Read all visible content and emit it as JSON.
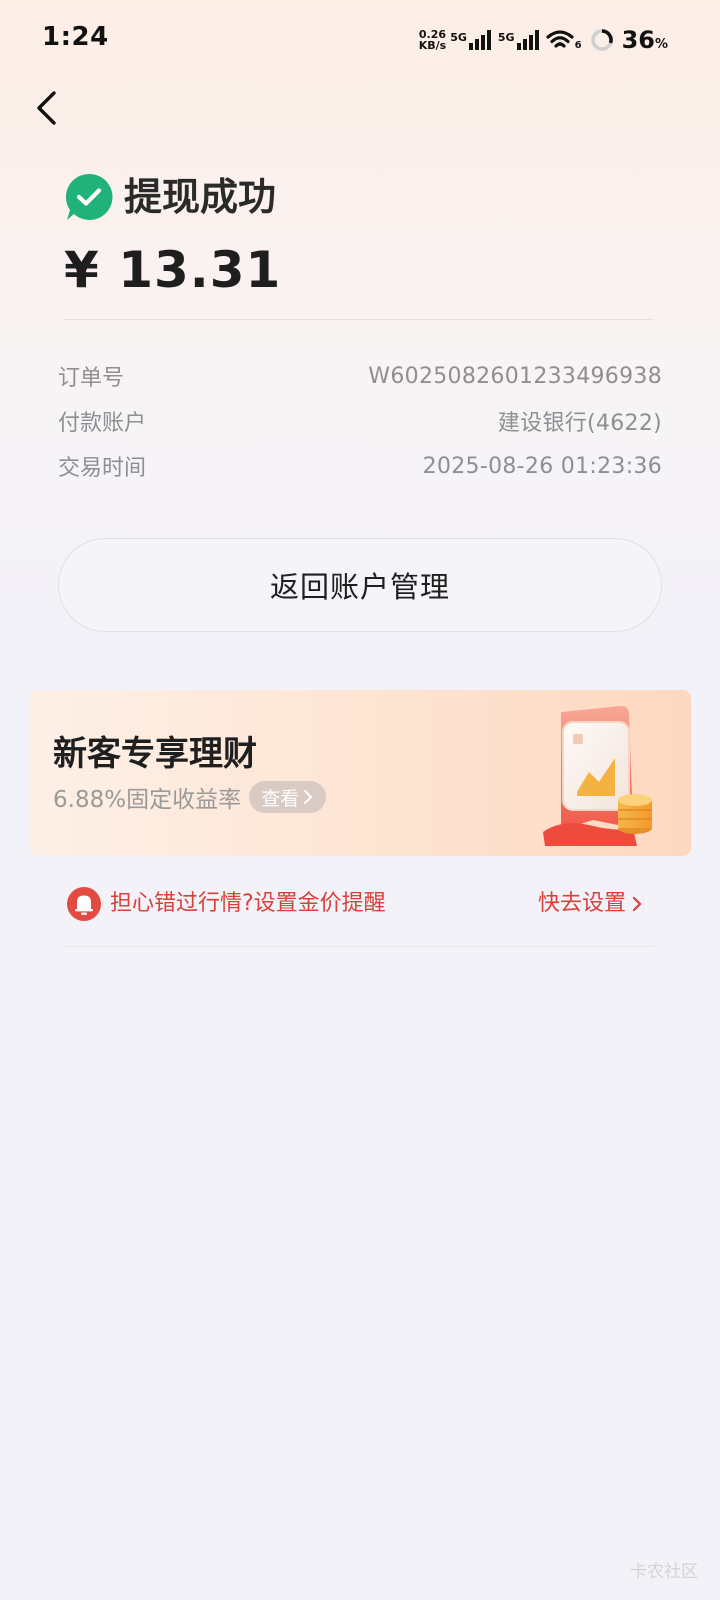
{
  "status_bar": {
    "time": "1:24",
    "net_speed_value": "0.26",
    "net_speed_unit": "KB/s",
    "sim1_label": "5G",
    "sim2_label": "5G",
    "wifi_sub": "6",
    "battery": "36",
    "battery_unit": "%"
  },
  "result": {
    "title": "提现成功",
    "amount": "¥ 13.31"
  },
  "details": {
    "order_label": "订单号",
    "order_value": "W6025082601233496938",
    "account_label": "付款账户",
    "account_value": "建设银行(4622)",
    "time_label": "交易时间",
    "time_value": "2025-08-26 01:23:36"
  },
  "actions": {
    "back_account_label": "返回账户管理"
  },
  "promo": {
    "title": "新客专享理财",
    "subtitle": "6.88%固定收益率",
    "view_label": "查看"
  },
  "alert": {
    "text": "担心错过行情?设置金价提醒",
    "action_label": "快去设置"
  },
  "watermark": "卡农社区",
  "colors": {
    "success_green": "#20b27a",
    "alert_red": "#d8403a"
  },
  "icons": {
    "back": "chevron-left-icon",
    "success": "check-circle-icon",
    "bell": "bell-icon"
  }
}
